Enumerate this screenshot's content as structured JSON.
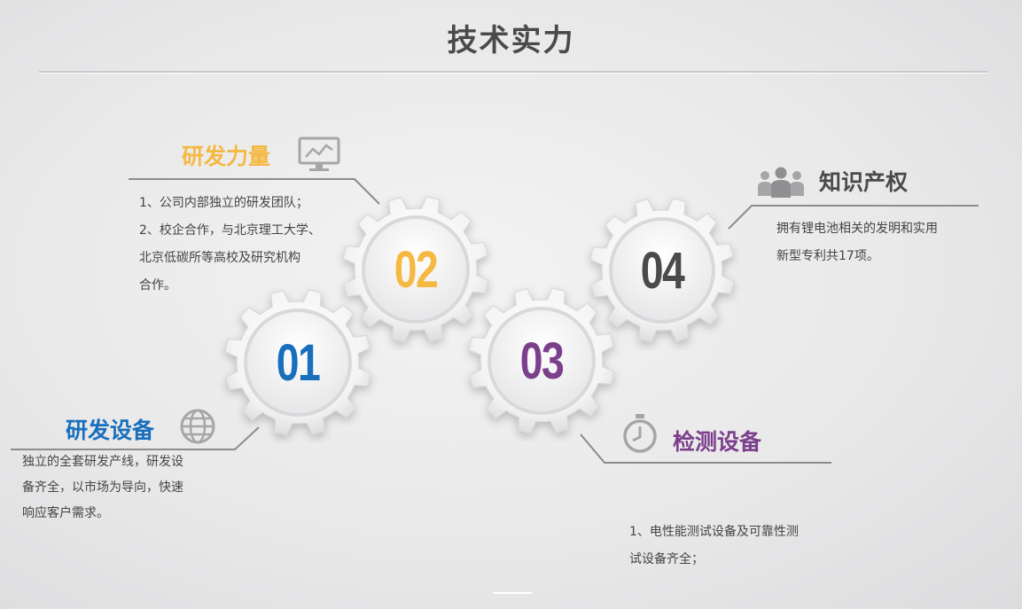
{
  "title": "技术实力",
  "sections": {
    "rd_power": {
      "number": "02",
      "heading": "研发力量",
      "color": "#f5b942",
      "icon": "monitor-chart-icon",
      "lines": [
        "1、公司内部独立的研发团队；",
        "2、校企合作，与北京理工大学、",
        "北京低碳所等高校及研究机构",
        "合作。"
      ]
    },
    "rd_equipment": {
      "number": "01",
      "heading": "研发设备",
      "color": "#1a6fbd",
      "icon": "globe-icon",
      "lines": [
        "独立的全套研发产线，研发设",
        "备齐全，以市场为导向，快速",
        "响应客户需求。"
      ]
    },
    "test_equipment": {
      "number": "03",
      "heading": "检测设备",
      "color": "#7b3f8c",
      "icon": "clock-icon",
      "lines": [
        "1、电性能测试设备及可靠性测",
        "试设备齐全；"
      ]
    },
    "ip": {
      "number": "04",
      "heading": "知识产权",
      "color": "#4a4a4a",
      "icon": "people-group-icon",
      "lines": [
        "拥有锂电池相关的发明和实用",
        "新型专利共17项。"
      ]
    }
  }
}
